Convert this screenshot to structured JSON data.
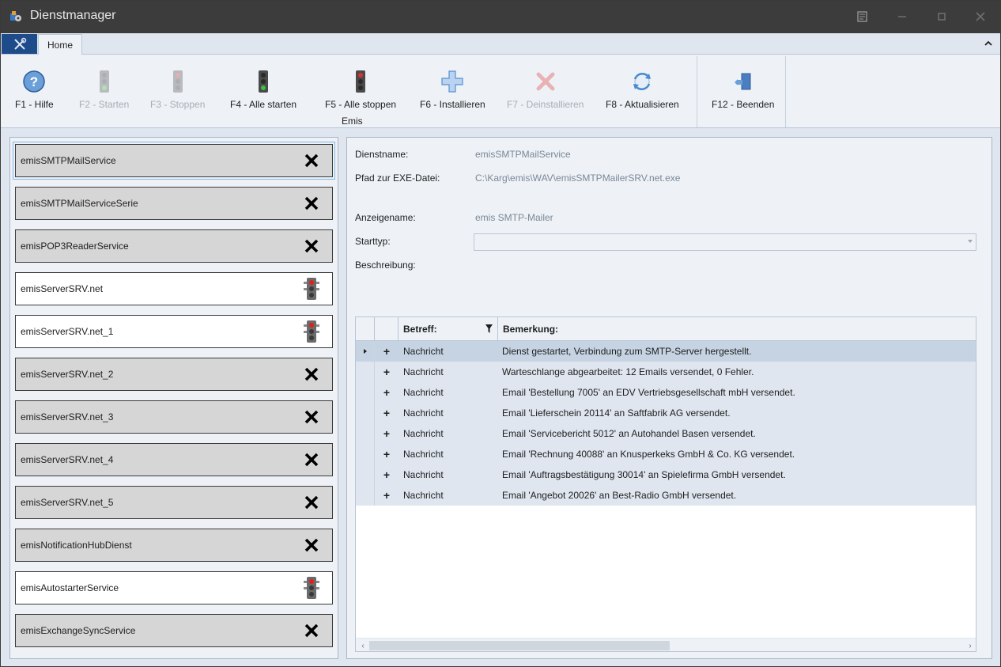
{
  "window": {
    "title": "Dienstmanager"
  },
  "ribbon": {
    "tab_home": "Home",
    "group_label": "Emis",
    "buttons": [
      {
        "label": "F1 - Hilfe",
        "icon": "help-icon",
        "enabled": true
      },
      {
        "label": "F2 - Starten",
        "icon": "traffic-light-green-icon",
        "enabled": false
      },
      {
        "label": "F3 - Stoppen",
        "icon": "traffic-light-red-icon",
        "enabled": false
      },
      {
        "label": "F4 - Alle starten",
        "icon": "traffic-light-green-icon",
        "enabled": true
      },
      {
        "label": "F5 - Alle stoppen",
        "icon": "traffic-light-red-icon",
        "enabled": true
      },
      {
        "label": "F6 - Installieren",
        "icon": "plus-icon",
        "enabled": true
      },
      {
        "label": "F7 - Deinstallieren",
        "icon": "remove-icon",
        "enabled": false
      },
      {
        "label": "F8 - Aktualisieren",
        "icon": "refresh-icon",
        "enabled": true
      },
      {
        "label": "F12 - Beenden",
        "icon": "exit-door-icon",
        "enabled": true
      }
    ]
  },
  "services": [
    {
      "name": "emisSMTPMailService",
      "status": "not-installed",
      "selected": true
    },
    {
      "name": "emisSMTPMailServiceSerie",
      "status": "not-installed"
    },
    {
      "name": "emisPOP3ReaderService",
      "status": "not-installed"
    },
    {
      "name": "emisServerSRV.net",
      "status": "stopped"
    },
    {
      "name": "emisServerSRV.net_1",
      "status": "stopped"
    },
    {
      "name": "emisServerSRV.net_2",
      "status": "not-installed"
    },
    {
      "name": "emisServerSRV.net_3",
      "status": "not-installed"
    },
    {
      "name": "emisServerSRV.net_4",
      "status": "not-installed"
    },
    {
      "name": "emisServerSRV.net_5",
      "status": "not-installed"
    },
    {
      "name": "emisNotificationHubDienst",
      "status": "not-installed"
    },
    {
      "name": "emisAutostarterService",
      "status": "stopped"
    },
    {
      "name": "emisExchangeSyncService",
      "status": "not-installed"
    }
  ],
  "details": {
    "dienstname_label": "Dienstname:",
    "dienstname_value": "emisSMTPMailService",
    "pfad_label": "Pfad zur EXE-Datei:",
    "pfad_value": "C:\\Karg\\emis\\WAV\\emisSMTPMailerSRV.net.exe",
    "anzeigename_label": "Anzeigename:",
    "anzeigename_value": "emis SMTP-Mailer",
    "starttyp_label": "Starttyp:",
    "starttyp_value": "",
    "beschreibung_label": "Beschreibung:"
  },
  "grid": {
    "col_betreff": "Betreff:",
    "col_bemerkung": "Bemerkung:",
    "rows": [
      {
        "betreff": "Nachricht",
        "bemerkung": "Dienst gestartet, Verbindung zum SMTP-Server hergestellt.",
        "current": true
      },
      {
        "betreff": "Nachricht",
        "bemerkung": "Warteschlange abgearbeitet: 12 Emails versendet, 0 Fehler."
      },
      {
        "betreff": "Nachricht",
        "bemerkung": "Email 'Bestellung 7005' an EDV Vertriebsgesellschaft mbH versendet."
      },
      {
        "betreff": "Nachricht",
        "bemerkung": "Email 'Lieferschein 20114' an Saftfabrik AG versendet."
      },
      {
        "betreff": "Nachricht",
        "bemerkung": "Email 'Servicebericht 5012' an Autohandel Basen versendet."
      },
      {
        "betreff": "Nachricht",
        "bemerkung": "Email 'Rechnung 40088' an Knusperkeks GmbH & Co. KG versendet."
      },
      {
        "betreff": "Nachricht",
        "bemerkung": "Email 'Auftragsbestätigung 30014' an Spielefirma GmbH versendet."
      },
      {
        "betreff": "Nachricht",
        "bemerkung": "Email 'Angebot 20026' an Best-Radio GmbH versendet."
      }
    ]
  },
  "colors": {
    "accent": "#1e4b8a",
    "titlebar": "#3c3c3c",
    "panel": "#eef2f7"
  }
}
